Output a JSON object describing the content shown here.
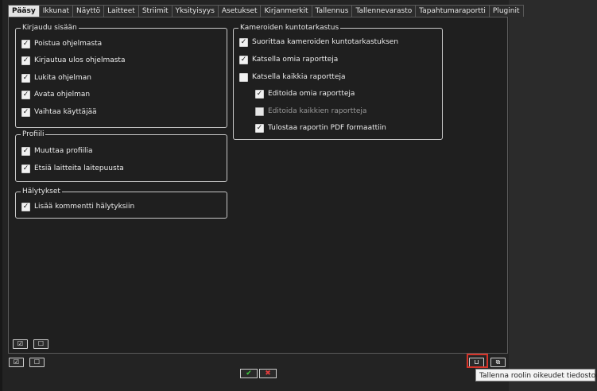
{
  "tabs": [
    {
      "label": "Pääsy",
      "active": true
    },
    {
      "label": "Ikkunat",
      "active": false
    },
    {
      "label": "Näyttö",
      "active": false
    },
    {
      "label": "Laitteet",
      "active": false
    },
    {
      "label": "Striimit",
      "active": false
    },
    {
      "label": "Yksityisyys",
      "active": false
    },
    {
      "label": "Asetukset",
      "active": false
    },
    {
      "label": "Kirjanmerkit",
      "active": false
    },
    {
      "label": "Tallennus",
      "active": false
    },
    {
      "label": "Tallennevarasto",
      "active": false
    },
    {
      "label": "Tapahtumaraportti",
      "active": false
    },
    {
      "label": "Pluginit",
      "active": false
    }
  ],
  "groups": {
    "login": {
      "title": "Kirjaudu sisään",
      "items": [
        {
          "label": "Poistua ohjelmasta",
          "checked": true
        },
        {
          "label": "Kirjautua ulos ohjelmasta",
          "checked": true
        },
        {
          "label": "Lukita ohjelman",
          "checked": true
        },
        {
          "label": "Avata ohjelman",
          "checked": true
        },
        {
          "label": "Vaihtaa käyttäjää",
          "checked": true
        }
      ]
    },
    "profile": {
      "title": "Profiili",
      "items": [
        {
          "label": "Muuttaa profiilia",
          "checked": true
        },
        {
          "label": "Etsiä laitteita laitepuusta",
          "checked": true
        }
      ]
    },
    "alarms": {
      "title": "Hälytykset",
      "items": [
        {
          "label": "Lisää kommentti hälytyksiin",
          "checked": true
        }
      ]
    },
    "camera_check": {
      "title": "Kameroiden kuntotarkastus",
      "items": [
        {
          "label": "Suorittaa kameroiden kuntotarkastuksen",
          "checked": true,
          "indent": 0,
          "disabled": false
        },
        {
          "label": "Katsella omia raportteja",
          "checked": true,
          "indent": 0,
          "disabled": false
        },
        {
          "label": "Katsella kaikkia raportteja",
          "checked": false,
          "indent": 0,
          "disabled": false
        },
        {
          "label": "Editoida omia raportteja",
          "checked": true,
          "indent": 1,
          "disabled": false
        },
        {
          "label": "Editoida kaikkien raportteja",
          "checked": false,
          "indent": 1,
          "disabled": true
        },
        {
          "label": "Tulostaa raportin PDF formaattiin",
          "checked": true,
          "indent": 1,
          "disabled": false
        }
      ]
    }
  },
  "buttons": {
    "select_all_glyph": "☑",
    "deselect_glyph": "☐",
    "ok_glyph": "✔",
    "cancel_glyph": "✖",
    "save_glyph": "⊔",
    "load_glyph": "⧉"
  },
  "tooltip": "Tallenna roolin oikeudet tiedostoon",
  "colors": {
    "accent_highlight": "#d6342a",
    "ok": "#3fcf3f",
    "cancel": "#e03c3c"
  }
}
